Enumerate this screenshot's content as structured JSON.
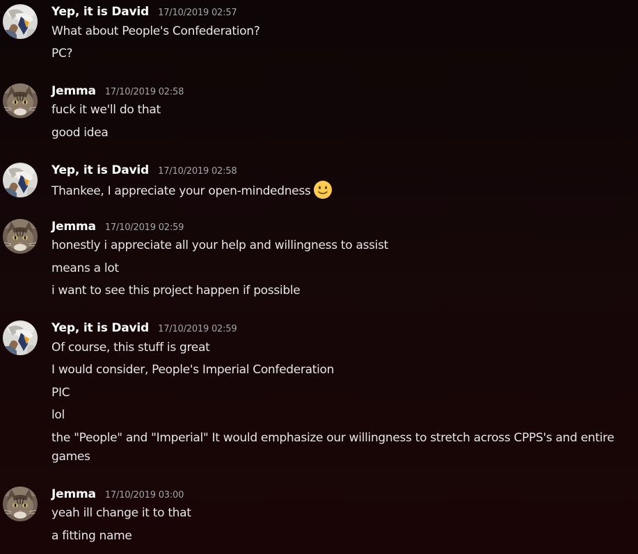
{
  "users": {
    "david": {
      "name": "Yep, it is David"
    },
    "jemma": {
      "name": "Jemma"
    }
  },
  "groups": [
    {
      "author": "Yep, it is David",
      "timestamp": "17/10/2019 02:57",
      "messages": [
        "What about People's Confederation?",
        "PC?"
      ]
    },
    {
      "author": "Jemma",
      "timestamp": "17/10/2019 02:58",
      "messages": [
        "fuck it we'll do that",
        "good idea"
      ]
    },
    {
      "author": "Yep, it is David",
      "timestamp": "17/10/2019 02:58",
      "messages": [
        "Thankee, I appreciate your open-mindedness"
      ],
      "emoji": "slightly-smiling-face-icon"
    },
    {
      "author": "Jemma",
      "timestamp": "17/10/2019 02:59",
      "messages": [
        "honestly i appreciate all your help and willingness to assist",
        "means a lot",
        "i want to see this project happen if possible"
      ]
    },
    {
      "author": "Yep, it is David",
      "timestamp": "17/10/2019 02:59",
      "messages": [
        "Of course, this stuff is great",
        "I would consider, People's Imperial Confederation",
        "PIC",
        "lol",
        "the \"People\" and \"Imperial\" It would emphasize our willingness to stretch across CPPS's and entire games"
      ]
    },
    {
      "author": "Jemma",
      "timestamp": "17/10/2019 03:00",
      "messages": [
        "yeah ill change it to that",
        "a fitting name"
      ]
    }
  ],
  "colors": {
    "background": "#120607",
    "author": "#ffffff",
    "timestamp": "#a3a6aa",
    "message": "#e6e6e6"
  }
}
